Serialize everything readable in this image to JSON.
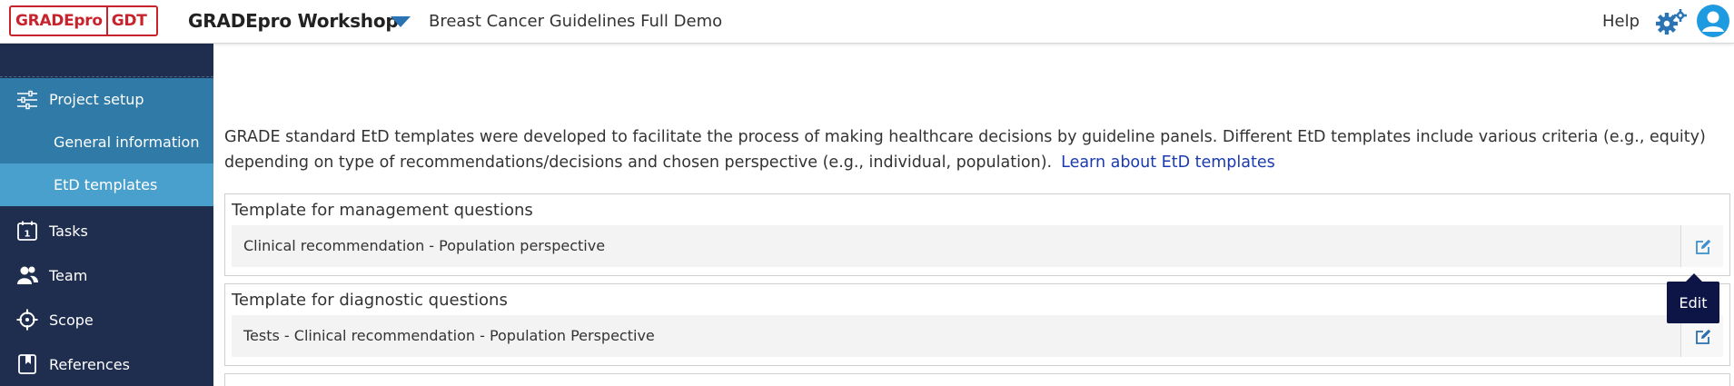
{
  "header": {
    "logo_left": "GRADEpro",
    "logo_right": "GDT",
    "workshop_title": "GRADEpro Workshop",
    "project_name": "Breast Cancer Guidelines Full Demo",
    "help_label": "Help",
    "icons": {
      "project_toggle": "caret-down-icon",
      "settings": "gear-icon",
      "user": "user-avatar-icon"
    },
    "accent_color": "#2b74b3",
    "brand_color": "#c8232c"
  },
  "sidebar": {
    "colors": {
      "background": "#1f2d4e",
      "active_section": "#2f7aa7",
      "selected_item": "#4aa0cc"
    },
    "items": [
      {
        "label": "Project setup",
        "icon": "sliders-icon"
      },
      {
        "label": "General information",
        "icon": ""
      },
      {
        "label": "EtD templates",
        "icon": ""
      },
      {
        "label": "Tasks",
        "icon": "calendar-icon"
      },
      {
        "label": "Team",
        "icon": "people-icon"
      },
      {
        "label": "Scope",
        "icon": "crosshair-icon"
      },
      {
        "label": "References",
        "icon": "bookmark-icon"
      }
    ]
  },
  "main": {
    "intro_text": "GRADE standard EtD templates were developed to facilitate the process of making healthcare decisions by guideline panels. Different EtD templates include various criteria (e.g., equity) depending on type of recommendations/decisions and chosen perspective (e.g., individual, population).",
    "learn_link": "Learn about EtD templates",
    "templates": [
      {
        "title": "Template for management questions",
        "name": "Clinical recommendation - Population perspective",
        "edit_icon": "edit-icon"
      },
      {
        "title": "Template for diagnostic questions",
        "name": "Tests - Clinical recommendation - Population Perspective",
        "edit_icon": "edit-icon"
      }
    ],
    "tooltip": "Edit"
  }
}
